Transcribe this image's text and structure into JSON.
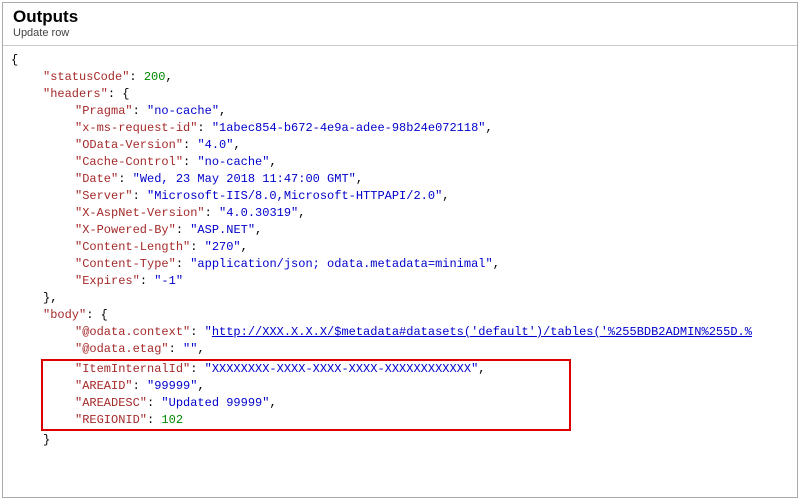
{
  "header": {
    "title": "Outputs",
    "subtitle": "Update row"
  },
  "json": {
    "open": "{",
    "statusCode_k": "\"statusCode\"",
    "statusCode_v": "200",
    "headers_k": "\"headers\"",
    "open2": "{",
    "pragma_k": "\"Pragma\"",
    "pragma_v": "\"no-cache\"",
    "xms_k": "\"x-ms-request-id\"",
    "xms_v": "\"1abec854-b672-4e9a-adee-98b24e072118\"",
    "odataver_k": "\"OData-Version\"",
    "odataver_v": "\"4.0\"",
    "cache_k": "\"Cache-Control\"",
    "cache_v": "\"no-cache\"",
    "date_k": "\"Date\"",
    "date_v": "\"Wed, 23 May 2018 11:47:00 GMT\"",
    "server_k": "\"Server\"",
    "server_v": "\"Microsoft-IIS/8.0,Microsoft-HTTPAPI/2.0\"",
    "aspnet_k": "\"X-AspNet-Version\"",
    "aspnet_v": "\"4.0.30319\"",
    "powered_k": "\"X-Powered-By\"",
    "powered_v": "\"ASP.NET\"",
    "clen_k": "\"Content-Length\"",
    "clen_v": "\"270\"",
    "ctype_k": "\"Content-Type\"",
    "ctype_v": "\"application/json; odata.metadata=minimal\"",
    "expires_k": "\"Expires\"",
    "expires_v": "\"-1\"",
    "close2": "},",
    "body_k": "\"body\"",
    "open3": "{",
    "ctx_k": "\"@odata.context\"",
    "ctx_pre": "\"",
    "ctx_link": "http://XXX.X.X.X/$metadata#datasets('default')/tables('%255BDB2ADMIN%255D.%",
    "etag_k": "\"@odata.etag\"",
    "etag_v": "\"\"",
    "itemid_k": "\"ItemInternalId\"",
    "itemid_v": "\"XXXXXXXX-XXXX-XXXX-XXXX-XXXXXXXXXXXX\"",
    "areaid_k": "\"AREAID\"",
    "areaid_v": "\"99999\"",
    "areadesc_k": "\"AREADESC\"",
    "areadesc_v": "\"Updated 99999\"",
    "regionid_k": "\"REGIONID\"",
    "regionid_v": "102",
    "close3": "}"
  },
  "punct": {
    "colon": ": ",
    "comma": ","
  }
}
